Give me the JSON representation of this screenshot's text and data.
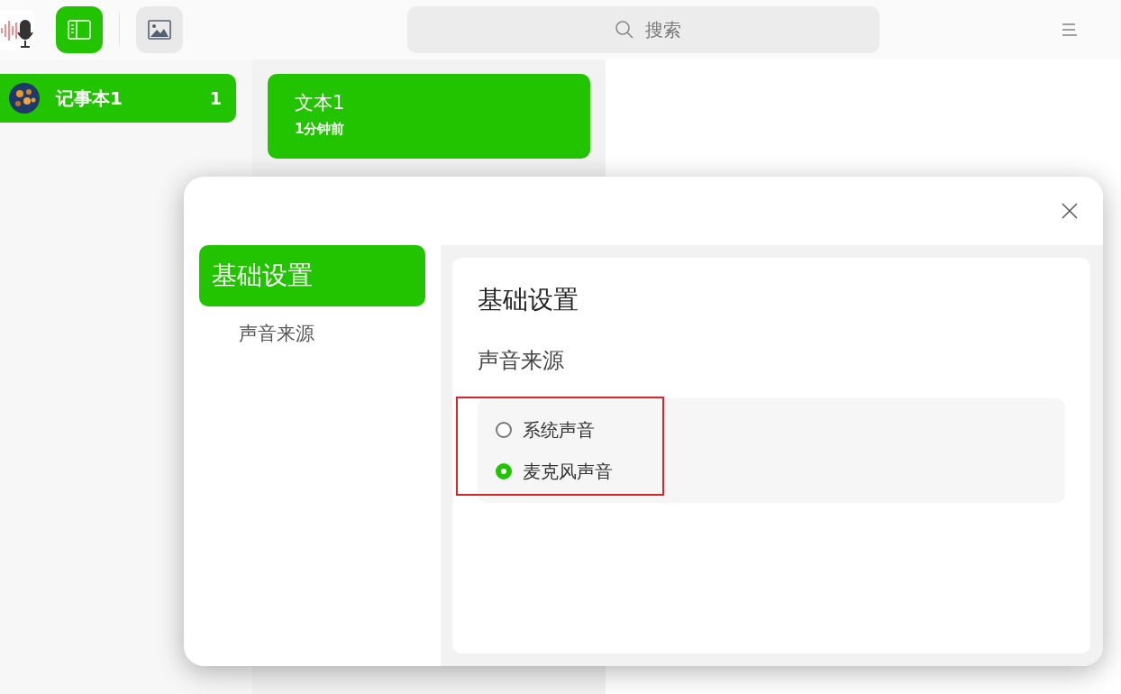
{
  "toolbar": {
    "buttons": [
      {
        "kind": "sidebar",
        "selected": true
      },
      {
        "kind": "image",
        "selected": false
      }
    ],
    "search": {
      "placeholder": "搜索"
    }
  },
  "notebooks": [
    {
      "name": "记事本1",
      "count": "1",
      "selected": true
    }
  ],
  "notes": [
    {
      "title": "文本1",
      "time": "1分钟前",
      "selected": true
    }
  ],
  "dialog": {
    "nav": [
      {
        "label": "基础设置",
        "kind": "group",
        "selected": true
      },
      {
        "label": "声音来源",
        "kind": "item",
        "selected": false
      }
    ],
    "heading": "基础设置",
    "section": "声音来源",
    "options": [
      {
        "label": "系统声音",
        "selected": false
      },
      {
        "label": "麦克风声音",
        "selected": true
      }
    ]
  }
}
